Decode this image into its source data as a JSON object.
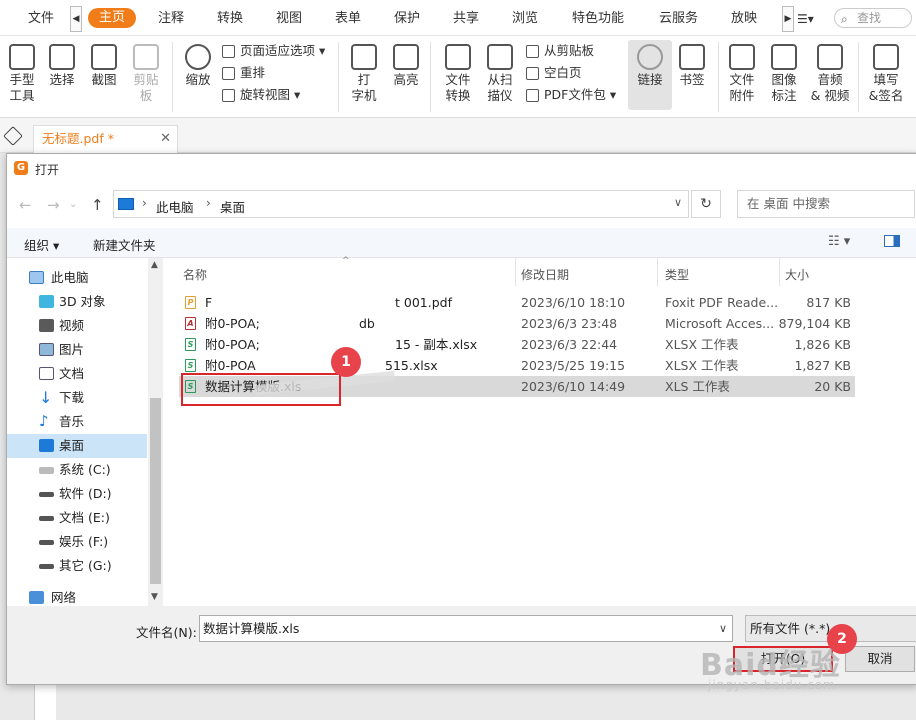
{
  "menu": {
    "tabs": [
      "文件",
      "主页",
      "注释",
      "转换",
      "视图",
      "表单",
      "保护",
      "共享",
      "浏览",
      "特色功能",
      "云服务",
      "放映"
    ],
    "search_placeholder": "查找"
  },
  "ribbon": {
    "hand_tool": "手型\n工具",
    "select": "选择",
    "screenshot": "截图",
    "clipboard": "剪贴\n板",
    "zoom": "缩放",
    "fit_page": "页面适应选项",
    "reflow": "重排",
    "rotate_view": "旋转视图",
    "typewriter": "打\n字机",
    "highlight": "高亮",
    "file_convert": "文件\n转换",
    "from_scanner": "从扫\n描仪",
    "from_clipboard": "从剪贴板",
    "blank_page": "空白页",
    "pdf_package": "PDF文件包",
    "link": "链接",
    "bookmark": "书签",
    "file_attach": "文件\n附件",
    "image_annot": "图像\n标注",
    "audio_video": "音频\n& 视频",
    "fill_sign": "填写\n&签名"
  },
  "doc_tab": {
    "label": "无标题.pdf *"
  },
  "dialog": {
    "title": "打开",
    "breadcrumb": [
      "此电脑",
      "桌面"
    ],
    "search_placeholder": "在 桌面 中搜索",
    "organize": "组织 ▾",
    "new_folder": "新建文件夹",
    "tree": [
      "此电脑",
      "3D 对象",
      "视频",
      "图片",
      "文档",
      "下载",
      "音乐",
      "桌面",
      "系统 (C:)",
      "软件 (D:)",
      "文档 (E:)",
      "娱乐 (F:)",
      "其它 (G:)",
      "网络"
    ],
    "columns": {
      "name": "名称",
      "date": "修改日期",
      "type": "类型",
      "size": "大小"
    },
    "files": [
      {
        "name": "F",
        "name_tail": "t 001.pdf",
        "date": "2023/6/10 18:10",
        "type": "Foxit PDF Reade...",
        "size": "817 KB",
        "icon": "pdf"
      },
      {
        "name": "附0-POA;",
        "name_tail": "db",
        "date": "2023/6/3 23:48",
        "type": "Microsoft Acces...",
        "size": "879,104 KB",
        "icon": "acc"
      },
      {
        "name": "附0-POA;",
        "name_tail": "15 - 副本.xlsx",
        "date": "2023/6/3 22:44",
        "type": "XLSX 工作表",
        "size": "1,826 KB",
        "icon": "xls"
      },
      {
        "name": "附0-POA",
        "name_tail": "515.xlsx",
        "date": "2023/5/25 19:15",
        "type": "XLSX 工作表",
        "size": "1,827 KB",
        "icon": "xls"
      },
      {
        "name": "数据计算模版.xls",
        "name_tail": "",
        "date": "2023/6/10 14:49",
        "type": "XLS 工作表",
        "size": "20 KB",
        "icon": "xls"
      }
    ],
    "filename_label": "文件名(N):",
    "filename_value": "数据计算模版.xls",
    "filter": "所有文件 (*.*)",
    "open_button": "打开(O)",
    "cancel_button": "取消"
  },
  "annotations": {
    "mark1": "1",
    "mark2": "2"
  },
  "watermark": {
    "text": "Baid经验",
    "url": "jingyan.baidu.com"
  },
  "colors": {
    "accent": "#f07d1a",
    "highlight_red": "#d9262c",
    "selection": "#cce4f7"
  }
}
